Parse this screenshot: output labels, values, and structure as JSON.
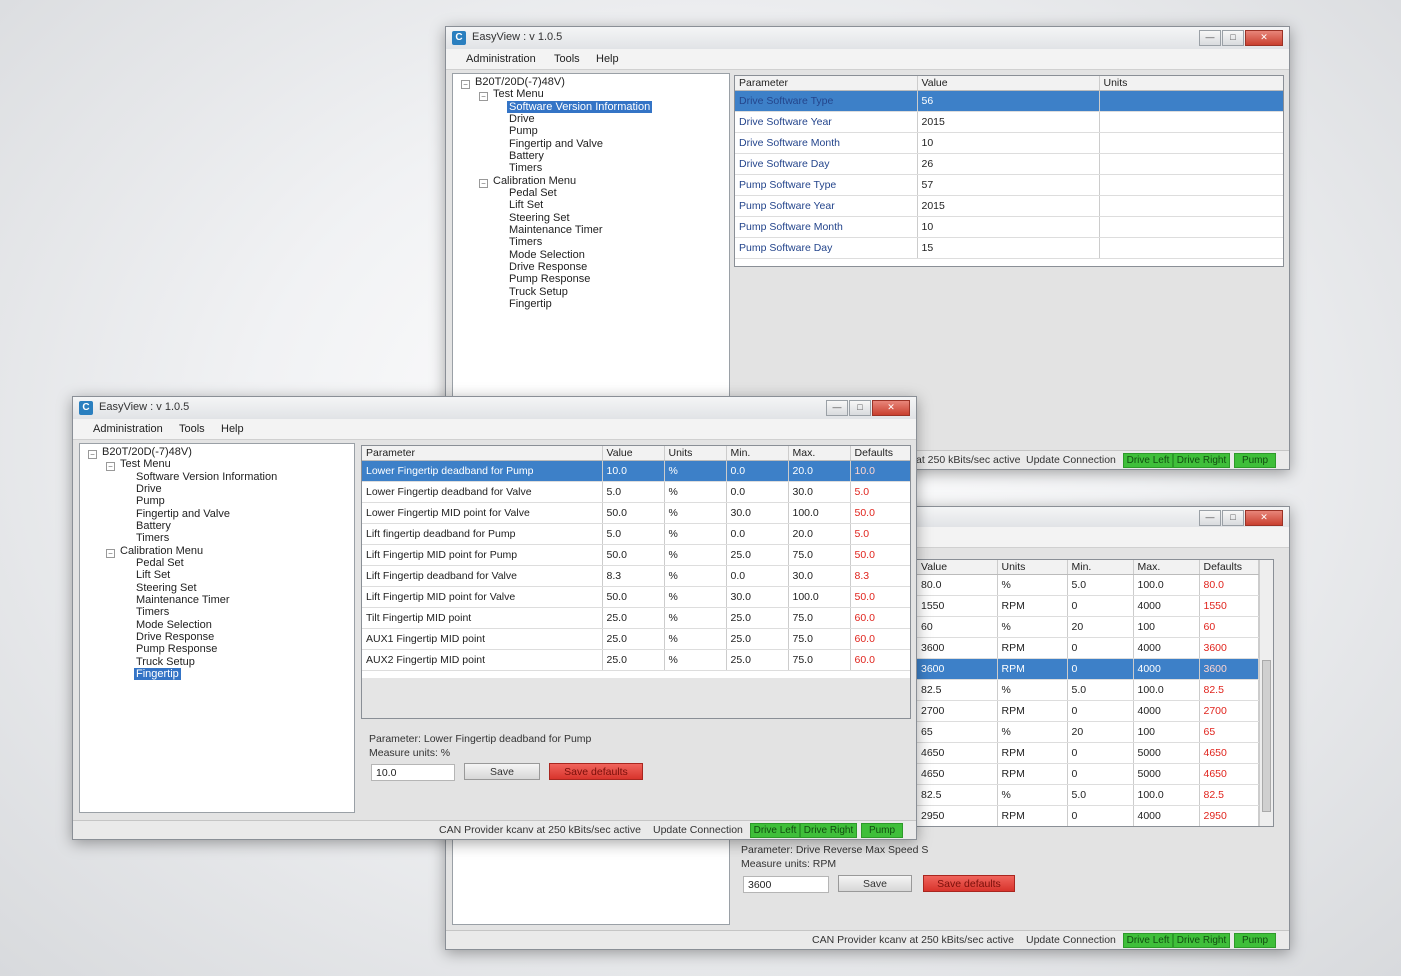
{
  "app": {
    "icon": "easyview-logo-icon",
    "title": "EasyView : v 1.0.5",
    "menu": [
      "Administration",
      "Tools",
      "Help"
    ],
    "window_buttons": {
      "minimize": "minimize-icon",
      "maximize": "maximize-icon",
      "close": "close-icon"
    }
  },
  "tree": {
    "root": "B20T/20D(-7)48V)",
    "test_menu": {
      "label": "Test Menu",
      "items": [
        "Software Version Information",
        "Drive",
        "Pump",
        "Fingertip and Valve",
        "Battery",
        "Timers"
      ]
    },
    "calibration_menu": {
      "label": "Calibration Menu",
      "items": [
        "Pedal Set",
        "Lift Set",
        "Steering Set",
        "Maintenance Timer",
        "Timers",
        "Mode Selection",
        "Drive Response",
        "Pump Response",
        "Truck Setup",
        "Fingertip"
      ]
    }
  },
  "software_info": {
    "headers": [
      "Parameter",
      "Value",
      "Units"
    ],
    "rows": [
      [
        "Drive Software Type",
        "56",
        ""
      ],
      [
        "Drive Software Year",
        "2015",
        ""
      ],
      [
        "Drive Software Month",
        "10",
        ""
      ],
      [
        "Drive Software Day",
        "26",
        ""
      ],
      [
        "Pump Software Type",
        "57",
        ""
      ],
      [
        "Pump Software Year",
        "2015",
        ""
      ],
      [
        "Pump Software Month",
        "10",
        ""
      ],
      [
        "Pump Software Day",
        "15",
        ""
      ]
    ],
    "selected_row": 0
  },
  "fingertip": {
    "headers": [
      "Parameter",
      "Value",
      "Units",
      "Min.",
      "Max.",
      "Defaults"
    ],
    "rows": [
      [
        "Lower Fingertip deadband for Pump",
        "10.0",
        "%",
        "0.0",
        "20.0",
        "10.0"
      ],
      [
        "Lower Fingertip deadband for Valve",
        "5.0",
        "%",
        "0.0",
        "30.0",
        "5.0"
      ],
      [
        "Lower Fingertip MID point for Valve",
        "50.0",
        "%",
        "30.0",
        "100.0",
        "50.0"
      ],
      [
        "Lift fingertip deadband for Pump",
        "5.0",
        "%",
        "0.0",
        "20.0",
        "5.0"
      ],
      [
        "Lift Fingertip MID point for Pump",
        "50.0",
        "%",
        "25.0",
        "75.0",
        "50.0"
      ],
      [
        "Lift Fingertip deadband for Valve",
        "8.3",
        "%",
        "0.0",
        "30.0",
        "8.3"
      ],
      [
        "Lift Fingertip MID point for Valve",
        "50.0",
        "%",
        "30.0",
        "100.0",
        "50.0"
      ],
      [
        "Tilt Fingertip MID point",
        "25.0",
        "%",
        "25.0",
        "75.0",
        "60.0"
      ],
      [
        "AUX1 Fingertip MID point",
        "25.0",
        "%",
        "25.0",
        "75.0",
        "60.0"
      ],
      [
        "AUX2 Fingertip MID point",
        "25.0",
        "%",
        "25.0",
        "75.0",
        "60.0"
      ]
    ],
    "selected_row": 0,
    "detail": {
      "parameter_line": "Parameter: Lower Fingertip deadband for Pump",
      "units_line": "Measure units: %",
      "value": "10.0",
      "save_label": "Save",
      "defaults_label": "Save defaults"
    }
  },
  "drive_params": {
    "headers": [
      "Value",
      "Units",
      "Min.",
      "Max.",
      "Defaults"
    ],
    "rows": [
      [
        "80.0",
        "%",
        "5.0",
        "100.0",
        "80.0"
      ],
      [
        "1550",
        "RPM",
        "0",
        "4000",
        "1550"
      ],
      [
        "60",
        "%",
        "20",
        "100",
        "60"
      ],
      [
        "3600",
        "RPM",
        "0",
        "4000",
        "3600"
      ],
      [
        "3600",
        "RPM",
        "0",
        "4000",
        "3600"
      ],
      [
        "82.5",
        "%",
        "5.0",
        "100.0",
        "82.5"
      ],
      [
        "2700",
        "RPM",
        "0",
        "4000",
        "2700"
      ],
      [
        "65",
        "%",
        "20",
        "100",
        "65"
      ],
      [
        "4650",
        "RPM",
        "0",
        "5000",
        "4650"
      ],
      [
        "4650",
        "RPM",
        "0",
        "5000",
        "4650"
      ],
      [
        "82.5",
        "%",
        "5.0",
        "100.0",
        "82.5"
      ],
      [
        "2950",
        "RPM",
        "0",
        "4000",
        "2950"
      ]
    ],
    "selected_row": 4,
    "detail": {
      "parameter_line": "Parameter: Drive Reverse Max Speed S",
      "units_line": "Measure units: RPM",
      "value": "3600",
      "save_label": "Save",
      "defaults_label": "Save defaults"
    }
  },
  "status": {
    "full_text": "CAN Provider kcanv at 250 kBits/sec active",
    "partial_text": "at 250 kBits/sec active",
    "update": "Update Connection",
    "indicators": [
      "Drive Left",
      "Drive Right",
      "Pump"
    ],
    "indicator_color": "#3fbf3a"
  },
  "colors": {
    "selection": "#3d80c8",
    "defaults_red": "#e0241d",
    "save_defaults_button": "#d8342c"
  }
}
